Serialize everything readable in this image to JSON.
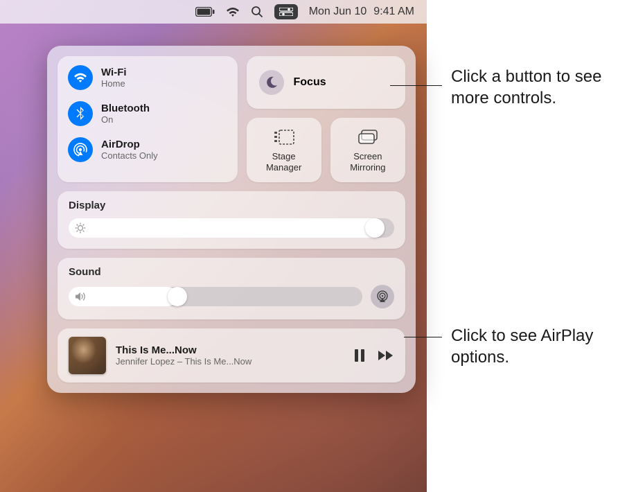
{
  "menubar": {
    "date": "Mon Jun 10",
    "time": "9:41 AM"
  },
  "connectivity": {
    "wifi": {
      "title": "Wi-Fi",
      "sub": "Home"
    },
    "bluetooth": {
      "title": "Bluetooth",
      "sub": "On"
    },
    "airdrop": {
      "title": "AirDrop",
      "sub": "Contacts Only"
    }
  },
  "focus": {
    "label": "Focus"
  },
  "tiles": {
    "stage": "Stage\nManager",
    "mirror": "Screen\nMirroring"
  },
  "display": {
    "label": "Display",
    "value": 97
  },
  "sound": {
    "label": "Sound",
    "value": 35
  },
  "nowPlaying": {
    "title": "This Is Me...Now",
    "artist": "Jennifer Lopez – This Is Me...Now"
  },
  "callouts": {
    "focus": "Click a button to see more controls.",
    "airplay": "Click to see AirPlay options."
  }
}
